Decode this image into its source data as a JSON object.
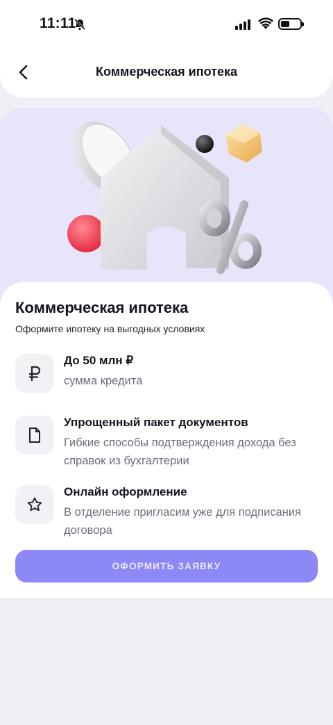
{
  "status_bar": {
    "time": "11:11"
  },
  "header": {
    "title": "Коммерческая ипотека"
  },
  "card": {
    "title": "Коммерческая ипотека",
    "subtitle": "Оформите ипотеку на выгодных условиях"
  },
  "features": [
    {
      "icon": "ruble-icon",
      "title": "До 50 млн ₽",
      "description": "сумма кредита"
    },
    {
      "icon": "document-icon",
      "title": "Упрощенный пакет документов",
      "description": "Гибкие способы подтверждения дохода без справок из бухгалтерии"
    },
    {
      "icon": "star-icon",
      "title": "Онлайн оформление",
      "description": "В отделение пригласим уже для подписания договора"
    }
  ],
  "cta": {
    "label": "ОФОРМИТЬ ЗАЯВКУ"
  },
  "colors": {
    "accent": "#8c88f6",
    "hero_bg": "#e6e5fa",
    "page_bg": "#eef0f5"
  }
}
